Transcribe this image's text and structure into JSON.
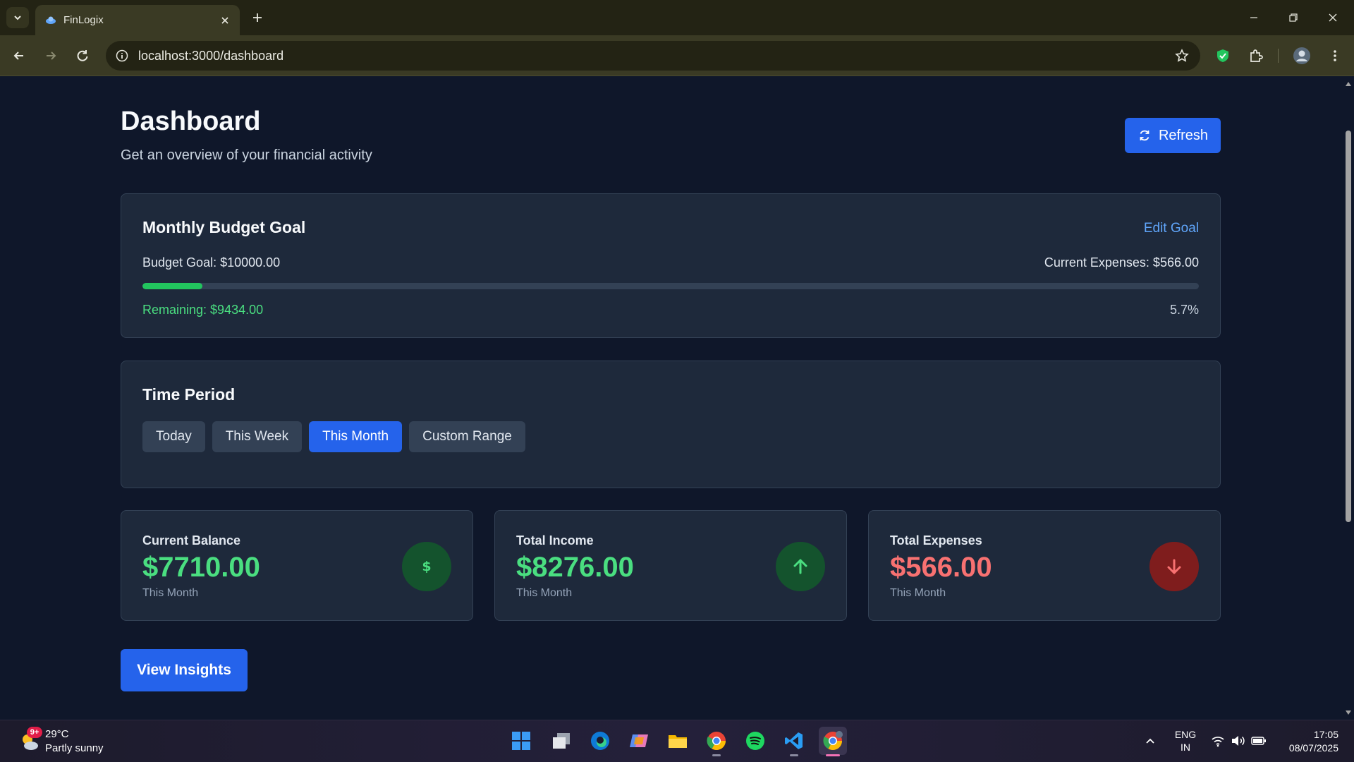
{
  "browser": {
    "tab_title": "FinLogix",
    "url": "localhost:3000/dashboard"
  },
  "page": {
    "title": "Dashboard",
    "subtitle": "Get an overview of your financial activity",
    "refresh_label": "Refresh"
  },
  "budget": {
    "heading": "Monthly Budget Goal",
    "edit_label": "Edit Goal",
    "goal_text": "Budget Goal: $10000.00",
    "current_expenses_text": "Current Expenses: $566.00",
    "remaining_text": "Remaining: $9434.00",
    "percent_text": "5.7%",
    "progress_fraction": 0.057,
    "progress_color": "#22c55e"
  },
  "time_period": {
    "heading": "Time Period",
    "options": [
      {
        "label": "Today",
        "active": false
      },
      {
        "label": "This Week",
        "active": false
      },
      {
        "label": "This Month",
        "active": true
      },
      {
        "label": "Custom Range",
        "active": false
      }
    ]
  },
  "stats": [
    {
      "label": "Current Balance",
      "value": "$7710.00",
      "sub": "This Month",
      "value_color": "#4ade80",
      "icon": "dollar-icon",
      "icon_bg": "#14532d",
      "icon_color": "#4ade80"
    },
    {
      "label": "Total Income",
      "value": "$8276.00",
      "sub": "This Month",
      "value_color": "#4ade80",
      "icon": "arrow-up-icon",
      "icon_bg": "#14532d",
      "icon_color": "#4ade80"
    },
    {
      "label": "Total Expenses",
      "value": "$566.00",
      "sub": "This Month",
      "value_color": "#f87171",
      "icon": "arrow-down-icon",
      "icon_bg": "#7f1d1d",
      "icon_color": "#f87171"
    }
  ],
  "insights_label": "View Insights",
  "taskbar": {
    "weather_temp": "29°C",
    "weather_desc": "Partly sunny",
    "weather_badge": "9+",
    "lang_line1": "ENG",
    "lang_line2": "IN",
    "time": "17:05",
    "date": "08/07/2025",
    "apps": [
      "windows-start-icon",
      "task-view-icon",
      "edge-icon",
      "copilot-icon",
      "file-explorer-icon",
      "chrome-icon",
      "spotify-icon",
      "vscode-icon",
      "chrome-active-icon"
    ]
  }
}
